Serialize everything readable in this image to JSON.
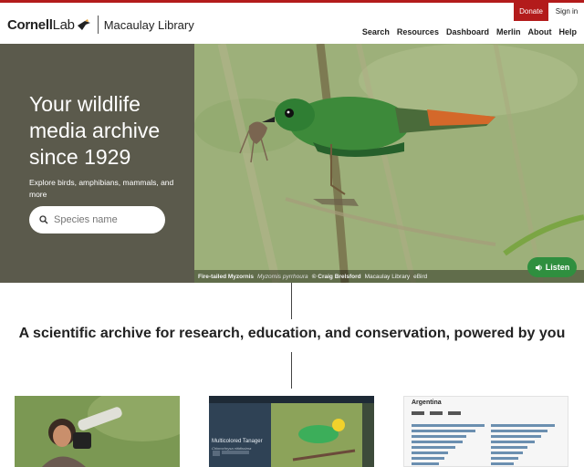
{
  "header": {
    "logo_cornell": "Cornell",
    "logo_lab": "Lab",
    "logo_library": "Macaulay Library",
    "donate_label": "Donate",
    "signin_label": "Sign in",
    "nav": [
      "Search",
      "Resources",
      "Dashboard",
      "Merlin",
      "About",
      "Help"
    ]
  },
  "hero": {
    "title": "Your wildlife media archive since 1929",
    "subtitle": "Explore birds, amphibians, mammals, and more",
    "search_placeholder": "Species name"
  },
  "photo": {
    "common_name": "Fire-tailed Myzornis",
    "scientific_name": "Myzornis pyrrhoura",
    "credit": "© Craig Brelsford",
    "source1": "Macaulay Library",
    "source2": "eBird",
    "listen_label": "Listen"
  },
  "tagline": "A scientific archive for research, education, and conservation, powered by you",
  "cards": {
    "card2_title": "Multicolored Tanager",
    "card2_sci": "Chlorochrysa nitidissima",
    "card3_title": "Argentina"
  },
  "colors": {
    "brand_red": "#b31b1b",
    "listen_green": "#2f8f3f",
    "hero_left": "#5b5a4c"
  }
}
